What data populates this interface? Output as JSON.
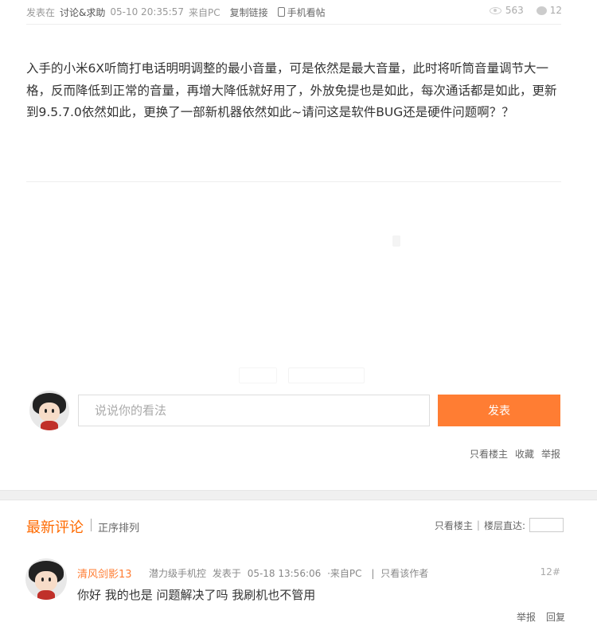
{
  "post": {
    "meta": {
      "posted_in_label": "发表在",
      "forum": "讨论&求助",
      "datetime": "05-10 20:35:57",
      "source": "来自PC",
      "copy_link": "复制链接",
      "mobile_view": "手机看帖"
    },
    "stats": {
      "views": "563",
      "replies": "12"
    },
    "body": "入手的小米6X听筒打电话明明调整的最小音量，可是依然是最大音量，此时将听筒音量调节大一格，反而降低到正常的音量，再增大降低就好用了，外放免提也是如此，每次通话都是如此，更新到9.5.7.0依然如此，更换了一部新机器依然如此~请问这是软件BUG还是硬件问题啊？？",
    "comment_box": {
      "placeholder": "说说你的看法",
      "submit": "发表"
    },
    "actions": {
      "only_op": "只看楼主",
      "favorite": "收藏",
      "report": "举报"
    }
  },
  "comments": {
    "title": "最新评论",
    "sort": "正序排列",
    "only_op": "只看楼主",
    "jump_label": "楼层直达:",
    "items": [
      {
        "username": "清风剑影13",
        "level": "潜力级手机控",
        "posted_label": "发表于",
        "datetime": "05-18 13:56:06",
        "source": "来自PC",
        "only_author": "只看该作者",
        "floor": "12#",
        "text": "你好 我的也是 问题解决了吗 我刷机也不管用",
        "report": "举报",
        "reply": "回复"
      }
    ]
  },
  "colors": {
    "accent": "#ff7d33",
    "title_orange": "#ff6a00"
  }
}
